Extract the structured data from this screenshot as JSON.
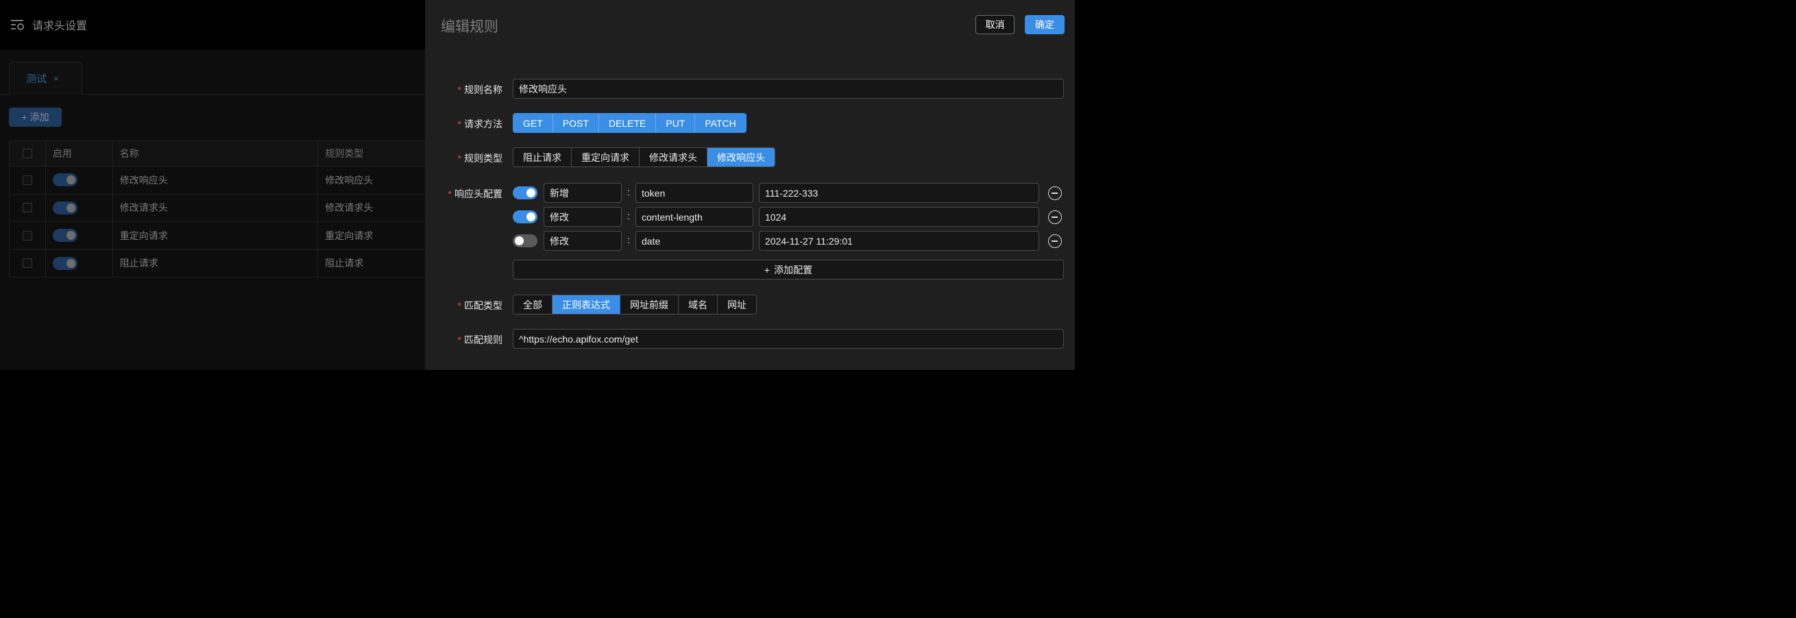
{
  "background": {
    "header_title": "请求头设置",
    "tab_label": "测试",
    "tab_close": "×",
    "add_button": "添加",
    "add_icon": "+",
    "table": {
      "columns": [
        "启用",
        "名称",
        "规则类型"
      ],
      "rows": [
        {
          "enabled": true,
          "name": "修改响应头",
          "type": "修改响应头"
        },
        {
          "enabled": true,
          "name": "修改请求头",
          "type": "修改请求头"
        },
        {
          "enabled": true,
          "name": "重定向请求",
          "type": "重定向请求"
        },
        {
          "enabled": true,
          "name": "阻止请求",
          "type": "阻止请求"
        }
      ]
    }
  },
  "drawer": {
    "title": "编辑规则",
    "cancel_label": "取消",
    "ok_label": "确定",
    "required_mark": "*",
    "rule_name": {
      "label": "规则名称",
      "value": "修改响应头"
    },
    "method": {
      "label": "请求方法",
      "options": [
        "GET",
        "POST",
        "DELETE",
        "PUT",
        "PATCH"
      ]
    },
    "rule_type": {
      "label": "规则类型",
      "options": [
        "阻止请求",
        "重定向请求",
        "修改请求头",
        "修改响应头"
      ],
      "selected": "修改响应头"
    },
    "header_config": {
      "label": "响应头配置",
      "separator": ":",
      "rows": [
        {
          "enabled": true,
          "op": "新增",
          "key": "token",
          "value": "111-222-333"
        },
        {
          "enabled": true,
          "op": "修改",
          "key": "content-length",
          "value": "1024"
        },
        {
          "enabled": false,
          "op": "修改",
          "key": "date",
          "value": "2024-11-27 11:29:01"
        }
      ],
      "add_label": "添加配置",
      "add_icon": "+"
    },
    "match_type": {
      "label": "匹配类型",
      "options": [
        "全部",
        "正则表达式",
        "网址前缀",
        "域名",
        "网址"
      ],
      "selected": "正则表达式"
    },
    "match_rule": {
      "label": "匹配规则",
      "value": "^https://echo.apifox.com/get"
    }
  },
  "colors": {
    "accent": "#3a8ee6",
    "required": "#e24b4b",
    "drawer_bg": "#1f1f1f"
  }
}
